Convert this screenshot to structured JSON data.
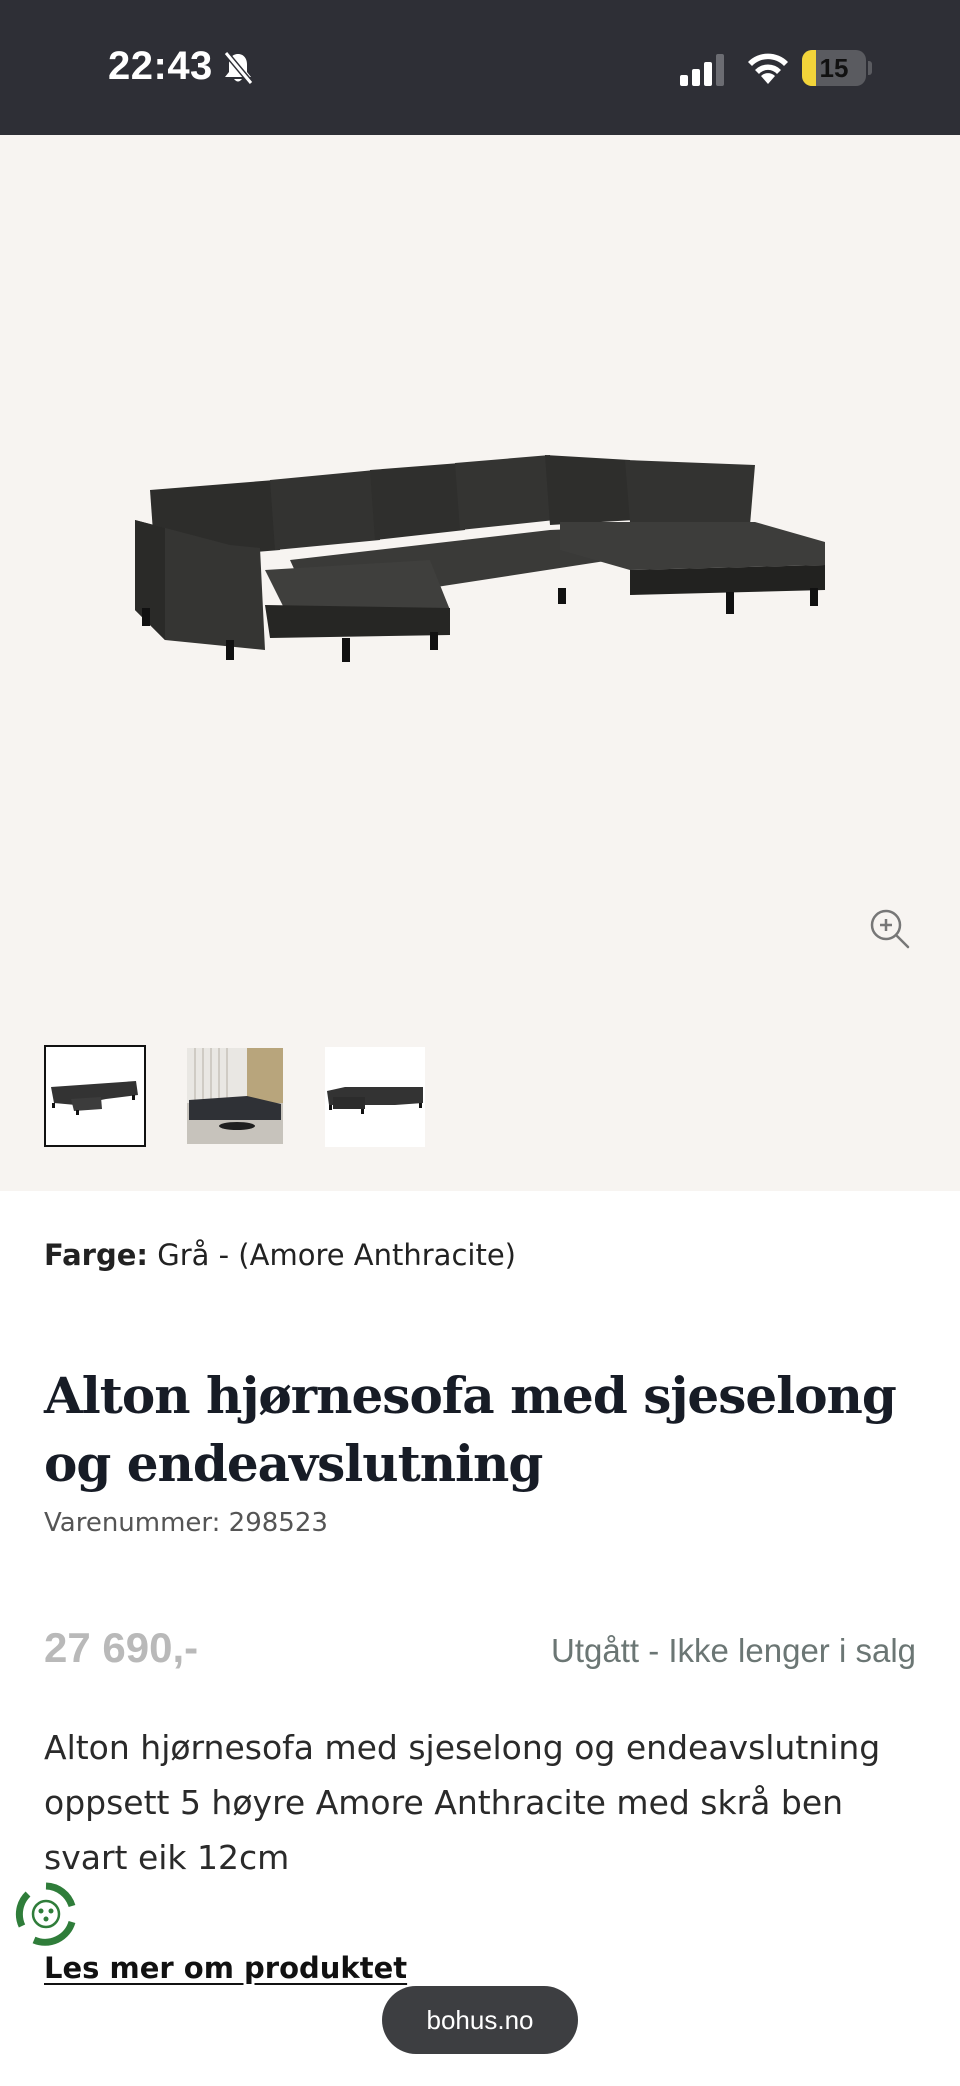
{
  "status_bar": {
    "time": "22:43",
    "battery_level": "15",
    "icons": [
      "bell-slash-icon",
      "cellular-signal-icon",
      "wifi-icon",
      "battery-icon"
    ]
  },
  "gallery": {
    "main_image": "sofa-image",
    "zoom_icon": "zoom-in-icon",
    "thumbnails": [
      "thumbnail-sofa",
      "thumbnail-living-room",
      "thumbnail-sofa-alt"
    ],
    "active_index": 0
  },
  "product": {
    "color_label": "Farge:",
    "color_value": "Grå - (Amore Anthracite)",
    "title": "Alton hjørnesofa med sjeselong og endeavslutning",
    "sku": "Varenummer: 298523",
    "price": "27 690,-",
    "availability": "Utgått - Ikke lenger i salg",
    "description": "Alton hjørnesofa med sjeselong og endeavslutning oppsett 5 høyre Amore Anthracite med skrå ben svart eik 12cm",
    "read_more": "Les mer om produktet"
  },
  "browser": {
    "url": "bohus.no"
  },
  "colors": {
    "status_bar_bg": "#2e2f36",
    "hero_bg": "#f7f4f1",
    "price_color": "#b9b9b9",
    "availability_color": "#6b7674",
    "eco_badge": "#2f7d3a"
  }
}
